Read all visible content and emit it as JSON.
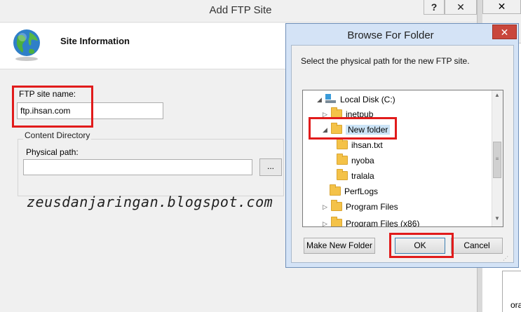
{
  "main_window": {
    "title": "Add FTP Site",
    "help_glyph": "?",
    "close_glyph": "✕",
    "heading": "Site Information",
    "ftp_name_label": "FTP site name:",
    "ftp_name_value": "ftp.ihsan.com",
    "content_dir_legend": "Content Directory",
    "physical_path_label": "Physical path:",
    "physical_path_value": "",
    "browse_button": "...",
    "globe_icon": "globe-icon"
  },
  "watermark": "zeusdanjaringan.blogspot.com",
  "background_window": {
    "close_glyph": "✕",
    "clipped_text": "ora"
  },
  "browse_dialog": {
    "title": "Browse For Folder",
    "close_glyph": "✕",
    "description": "Select the physical path for the new FTP site.",
    "tree": [
      {
        "label": "Local Disk (C:)",
        "expander": "◢",
        "icon": "drive-icon"
      },
      {
        "label": "inetpub",
        "expander": "▷",
        "icon": "folder-icon"
      },
      {
        "label": "New folder",
        "expander": "◢",
        "icon": "folder-icon",
        "selected": true
      },
      {
        "label": "ihsan.txt",
        "expander": "",
        "icon": "folder-icon"
      },
      {
        "label": "nyoba",
        "expander": "",
        "icon": "folder-icon"
      },
      {
        "label": "tralala",
        "expander": "",
        "icon": "folder-icon"
      },
      {
        "label": "PerfLogs",
        "expander": "",
        "icon": "folder-icon"
      },
      {
        "label": "Program Files",
        "expander": "▷",
        "icon": "folder-icon"
      },
      {
        "label": "Program Files (x86)",
        "expander": "▷",
        "icon": "folder-icon"
      }
    ],
    "make_new_folder": "Make New Folder",
    "ok": "OK",
    "cancel": "Cancel"
  },
  "colors": {
    "annotation_red": "#e11b1b",
    "dialog_frame": "#d4e3f6",
    "close_red": "#c9473c",
    "selection": "#cce4f7"
  }
}
